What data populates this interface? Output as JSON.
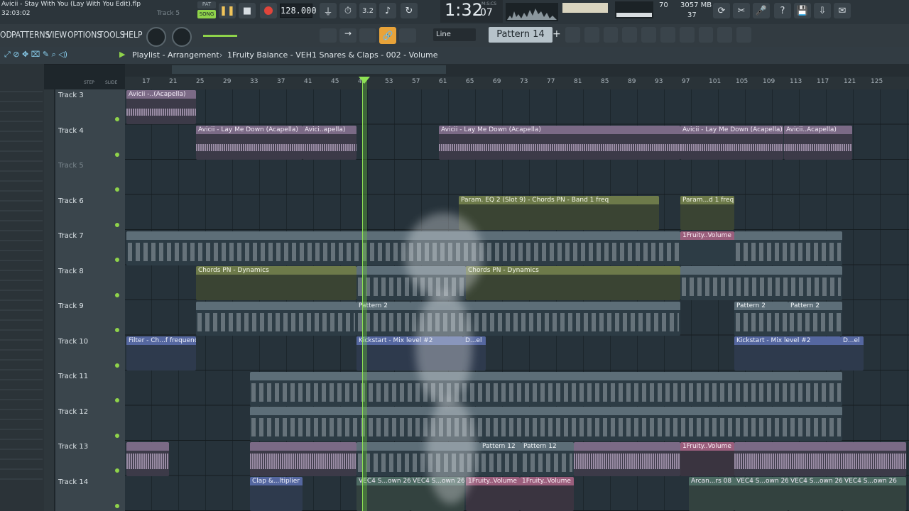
{
  "window": {
    "title": "Avicii - Stay With You (Lay With You Edit).flp",
    "time_elapsed": "32:03:02",
    "hint_track": "Track 5"
  },
  "transport": {
    "pat_label": "PAT",
    "song_label": "SONG",
    "tempo": "128.000",
    "time": "1:32",
    "time_sub": "07",
    "time_unit": "M:S:CS",
    "cpu": "70",
    "memory": "3057 MB",
    "voices": "37"
  },
  "menu": [
    "OD",
    "PATTERNS",
    "VIEW",
    "OPTIONS",
    "TOOLS",
    "HELP"
  ],
  "toolbar": {
    "snap": "Line",
    "pattern": "Pattern 14"
  },
  "playlist": {
    "title": "Playlist - Arrangement",
    "breadcrumb": "1Fruity Balance - VEH1 Snares & Claps - 002 - Volume",
    "step_label": "STEP",
    "slide_label": "SLIDE"
  },
  "ruler": [
    "17",
    "21",
    "25",
    "29",
    "33",
    "37",
    "41",
    "45",
    "49",
    "53",
    "57",
    "61",
    "65",
    "69",
    "73",
    "77",
    "81",
    "85",
    "89",
    "93",
    "97",
    "101",
    "105",
    "109",
    "113",
    "117",
    "121",
    "125"
  ],
  "tracks": [
    {
      "label": "Track 3",
      "dim": false
    },
    {
      "label": "Track 4",
      "dim": false
    },
    {
      "label": "Track 5",
      "dim": true
    },
    {
      "label": "Track 6",
      "dim": false
    },
    {
      "label": "Track 7",
      "dim": false
    },
    {
      "label": "Track 8",
      "dim": false
    },
    {
      "label": "Track 9",
      "dim": false
    },
    {
      "label": "Track 10",
      "dim": false
    },
    {
      "label": "Track 11",
      "dim": false
    },
    {
      "label": "Track 12",
      "dim": false
    },
    {
      "label": "Track 13",
      "dim": false
    },
    {
      "label": "Track 14",
      "dim": false
    }
  ],
  "clips": {
    "t3a": "Avicii -..(Acapella)",
    "t4a": "Avicii - Lay Me Down (Acapella)",
    "t4b": "Avici..apella)",
    "t4c": "Avicii - Lay Me Down (Acapella)",
    "t4d": "Avicii - Lay Me Down (Acapella)",
    "t4e": "Avicii..Acapella)",
    "t6a": "Param. EQ 2 (Slot 9) - Chords PN - Band 1 freq",
    "t6b": "Param...d 1 freq",
    "t7a": "1Fruity..Volume",
    "t8a": "Chords PN - Dynamics",
    "t8b": "Chords PN - Dynamics",
    "t9a": "Pattern 2",
    "t9b": "Pattern 2",
    "t9c": "Pattern 2",
    "t10a": "Filter - Ch...f frequency",
    "t10b": "Kickstart - Mix level #2",
    "t10c": "D...el",
    "t10d": "Kickstart - Mix level #2",
    "t10e": "D...el",
    "t13a": "Pattern 12",
    "t13b": "Pattern 12",
    "t13c": "1Fruity..Volume",
    "t14a": "Clap &...ltiplier",
    "t14b": "VEC4 S...own 26",
    "t14c": "VEC4 S...own 26",
    "t14d": "1Fruity..Volume",
    "t14e": "1Fruity..Volume",
    "t14f": "Arcan...rs 08",
    "t14g": "VEC4 S...own 26",
    "t14h": "VEC4 S...own 26",
    "t14i": "VEC4 S...own 26"
  },
  "colors": {
    "accent_green": "#8fd34a",
    "audio_clip": "#7b6a86",
    "automation_clip": "#6d7a4a",
    "pattern_clip": "#5d6e78"
  }
}
